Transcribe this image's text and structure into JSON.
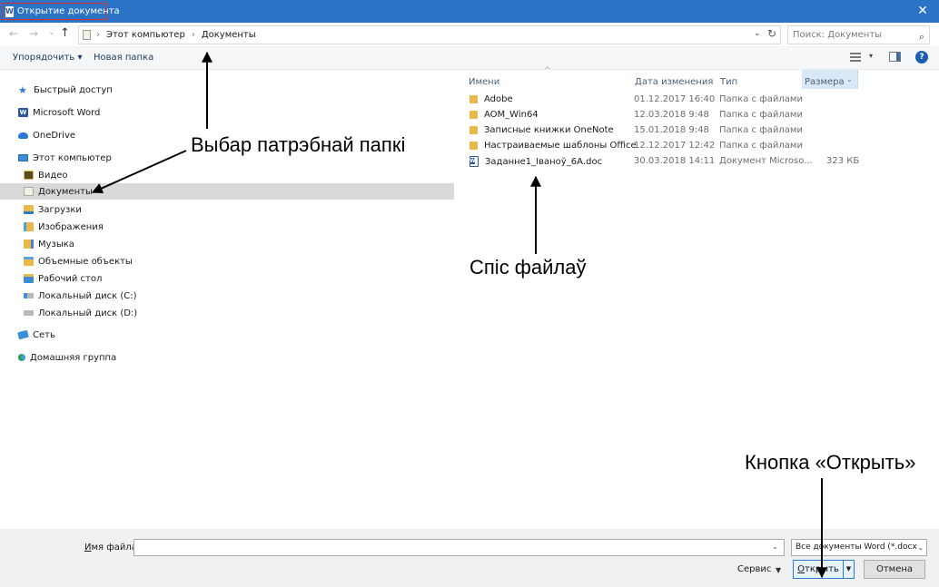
{
  "window": {
    "title": "Открытие документа",
    "app_icon_letter": "W",
    "close_glyph": "✕"
  },
  "nav": {
    "back_glyph": "←",
    "forward_glyph": "→",
    "recent_glyph": "⌄",
    "up_glyph": "↑",
    "breadcrumb": [
      "Этот компьютер",
      "Документы"
    ],
    "separator": "›",
    "refresh_glyph": "↻",
    "search_placeholder": "Поиск: Документы",
    "search_glyph": "⌕"
  },
  "commands": {
    "organize": "Упорядочить ▾",
    "new_folder": "Новая папка",
    "view_drop": "▾",
    "help": "?"
  },
  "sidebar": {
    "items": [
      {
        "label": "Быстрый доступ",
        "icon": "star-icon"
      },
      {
        "label": "Microsoft Word",
        "icon": "word-icon"
      },
      {
        "label": "OneDrive",
        "icon": "cloud-icon"
      },
      {
        "label": "Этот компьютер",
        "icon": "computer-icon"
      },
      {
        "label": "Видео",
        "icon": "video-folder-icon"
      },
      {
        "label": "Документы",
        "icon": "documents-folder-icon",
        "selected": true
      },
      {
        "label": "Загрузки",
        "icon": "downloads-folder-icon"
      },
      {
        "label": "Изображения",
        "icon": "pictures-folder-icon"
      },
      {
        "label": "Музыка",
        "icon": "music-folder-icon"
      },
      {
        "label": "Объемные объекты",
        "icon": "3d-objects-folder-icon"
      },
      {
        "label": "Рабочий стол",
        "icon": "desktop-folder-icon"
      },
      {
        "label": "Локальный диск (C:)",
        "icon": "system-disk-icon"
      },
      {
        "label": "Локальный диск (D:)",
        "icon": "disk-icon"
      },
      {
        "label": "Сеть",
        "icon": "network-icon"
      },
      {
        "label": "Домашняя группа",
        "icon": "homegroup-icon"
      }
    ]
  },
  "filelist": {
    "columns": {
      "name": "Имени",
      "date": "Дата изменения",
      "type": "Тип",
      "size": "Размера"
    },
    "sort_caret": "^",
    "size_drop": "⌄",
    "rows": [
      {
        "name": "Adobe",
        "date": "01.12.2017 16:40",
        "type": "Папка с файлами",
        "size": "",
        "icon": "folder-icon"
      },
      {
        "name": "AOM_Win64",
        "date": "12.03.2018 9:48",
        "type": "Папка с файлами",
        "size": "",
        "icon": "folder-icon"
      },
      {
        "name": "Записные книжки OneNote",
        "date": "15.01.2018 9:48",
        "type": "Папка с файлами",
        "size": "",
        "icon": "folder-icon"
      },
      {
        "name": "Настраиваемые шаблоны Office",
        "date": "12.12.2017 12:42",
        "type": "Папка с файлами",
        "size": "",
        "icon": "folder-icon"
      },
      {
        "name": "Заданне1_Іваноў_6А.doc",
        "date": "30.03.2018 14:11",
        "type": "Документ Microso...",
        "size": "323 КБ",
        "icon": "word-doc-icon"
      }
    ]
  },
  "annotations": {
    "folder_choice": "Выбар патрэбнай папкі",
    "file_list": "Спіс файлаў",
    "open_button": "Кнопка «Открыть»"
  },
  "bottom": {
    "filename_label_u": "И",
    "filename_label_rest": "мя файла:",
    "filename_value": "",
    "filter": "Все документы Word (*.docx*.",
    "drop_glyph": "⌄",
    "service": "Сервис",
    "service_drop": "▼",
    "open_u": "О",
    "open_rest": "ткрыть",
    "open_split": "▼",
    "cancel": "Отмена"
  }
}
